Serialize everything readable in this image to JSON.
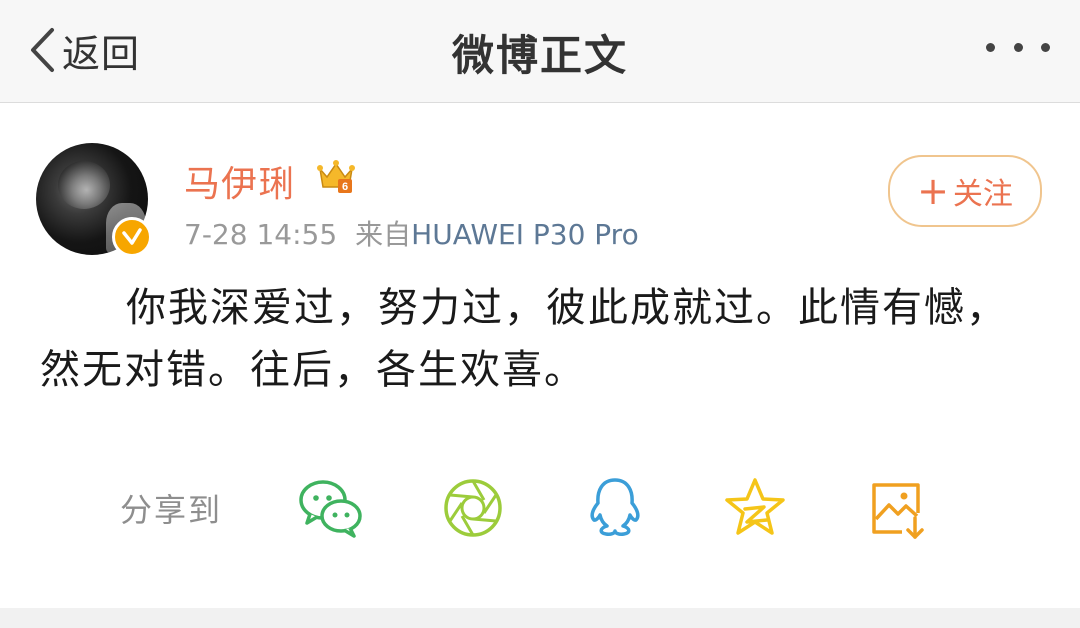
{
  "nav": {
    "back_label": "返回",
    "title": "微博正文",
    "more_icon": "more-dots-icon"
  },
  "post": {
    "author": "马伊琍",
    "time": "7-28 14:55",
    "source_prefix": "来自",
    "source_device": "HUAWEI P30 Pro",
    "follow_label": "关注",
    "follow_plus": "+",
    "text": "你我深爱过，努力过，彼此成就过。此情有憾，然无对错。往后，各生欢喜。"
  },
  "share": {
    "label": "分享到",
    "targets": [
      "wechat-icon",
      "moments-icon",
      "qq-icon",
      "qzone-icon",
      "save-image-icon"
    ]
  },
  "colors": {
    "accent": "#eb7350",
    "link": "#5d7895",
    "wechat": "#3fb35f",
    "moments": "#9ccc3b",
    "qq": "#3b9ed8",
    "qzone": "#f5c518",
    "save": "#f0a020"
  }
}
